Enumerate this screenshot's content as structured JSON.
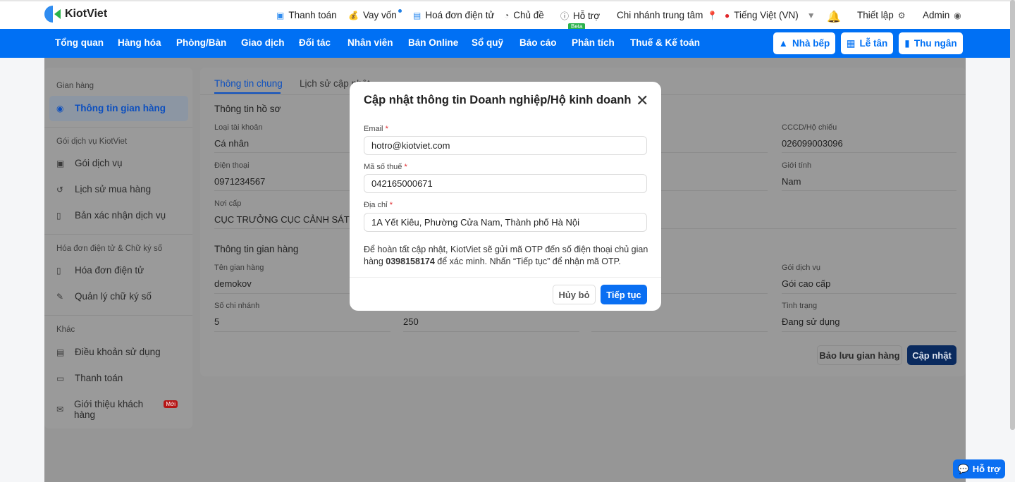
{
  "brand": "KiotViet",
  "topbar": {
    "payment": "Thanh toán",
    "loan": "Vay vốn",
    "einvoice": "Hoá đơn điện tử",
    "theme": "Chủ đề",
    "support": "Hỗ trợ",
    "beta": "Beta",
    "branch": "Chi nhánh trung tâm",
    "language": "Tiếng Việt (VN)",
    "settings": "Thiết lập",
    "user": "Admin"
  },
  "nav": {
    "items": [
      "Tổng quan",
      "Hàng hóa",
      "Phòng/Bàn",
      "Giao dịch",
      "Đối tác",
      "Nhân viên",
      "Bán Online",
      "Sổ quỹ",
      "Báo cáo",
      "Phân tích",
      "Thuế & Kế toán"
    ],
    "kitchen": "Nhà bếp",
    "reception": "Lễ tân",
    "cashier": "Thu ngân"
  },
  "sidebar": {
    "h1": "Gian hàng",
    "store_info": "Thông tin gian hàng",
    "h2": "Gói dịch vụ KiotViet",
    "service": "Gói dịch vụ",
    "history": "Lịch sử mua hàng",
    "confirm": "Bản xác nhận dịch vụ",
    "h3": "Hóa đơn điện tử & Chữ ký số",
    "einvoice": "Hóa đơn điện tử",
    "signature": "Quản lý chữ ký số",
    "h4": "Khác",
    "terms": "Điều khoản sử dụng",
    "payment": "Thanh toán",
    "referral": "Giới thiệu khách hàng",
    "new_badge": "Mới"
  },
  "main": {
    "tabs": [
      "Thông tin chung",
      "Lịch sử cập nhật"
    ],
    "profile_title": "Thông tin hồ sơ",
    "account_type_label": "Loại tài khoản",
    "account_type": "Cá nhân",
    "id_label": "CCCD/Hộ chiếu",
    "id": "026099003096",
    "phone_label": "Điện thoại",
    "phone": "0971234567",
    "gender_label": "Giới tính",
    "gender": "Nam",
    "issued_label": "Nơi cấp",
    "issued": "CỤC TRƯỞNG CỤC CẢNH SÁT QU",
    "store_title": "Thông tin gian hàng",
    "store_name_label": "Tên gian hàng",
    "store_name": "demokov",
    "plan_label": "Gói dịch vụ",
    "plan": "Gói cao cấp",
    "branches_label": "Số chi nhánh",
    "branches": "5",
    "col2_value": "250",
    "status_label": "Tình trạng",
    "status": "Đang sử dụng",
    "archive": "Bảo lưu gian hàng",
    "update": "Cập nhật"
  },
  "modal": {
    "title": "Cập nhật thông tin Doanh nghiệp/Hộ kinh doanh",
    "email_label": "Email",
    "email": "hotro@kiotviet.com",
    "tax_label": "Mã số thuế",
    "tax": "042165000671",
    "address_label": "Địa chỉ",
    "address": "1A Yết Kiêu, Phường Cửa Nam, Thành phố Hà Nội",
    "required": "*",
    "note_pre": "Để hoàn tất cập nhật, KiotViet sẽ gửi mã OTP đến số điện thoại chủ gian hàng ",
    "note_phone": "0398158174",
    "note_post": " để xác minh. Nhấn “Tiếp tục” để nhận mã OTP.",
    "cancel": "Hủy bỏ",
    "continue": "Tiếp tục"
  },
  "help_widget": "Hỗ trợ"
}
